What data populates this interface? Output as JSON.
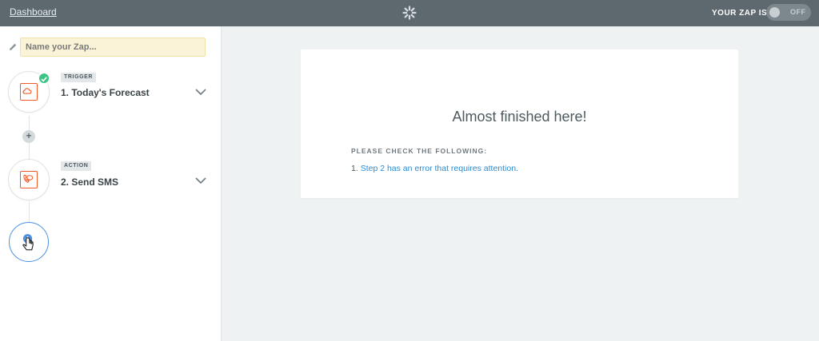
{
  "topbar": {
    "dashboard_link": "Dashboard",
    "zap_status_label": "YOUR ZAP IS",
    "toggle_state": "OFF"
  },
  "sidebar": {
    "name_placeholder": "Name your Zap...",
    "steps": [
      {
        "badge": "TRIGGER",
        "title": "1. Today's Forecast",
        "icon": "cloud-icon",
        "completed": true
      },
      {
        "badge": "ACTION",
        "title": "2. Send SMS",
        "icon": "sms-icon",
        "completed": false
      }
    ]
  },
  "main": {
    "heading": "Almost finished here!",
    "check_label": "PLEASE CHECK THE FOLLOWING:",
    "errors": [
      {
        "prefix": "1.",
        "text": "Step 2 has an error that requires attention."
      }
    ]
  },
  "colors": {
    "topbar": "#5e696f",
    "accent_orange": "#f05a28",
    "success_green": "#3bc486",
    "link_blue": "#2a8bd3",
    "input_bg": "#fbf3d7"
  }
}
